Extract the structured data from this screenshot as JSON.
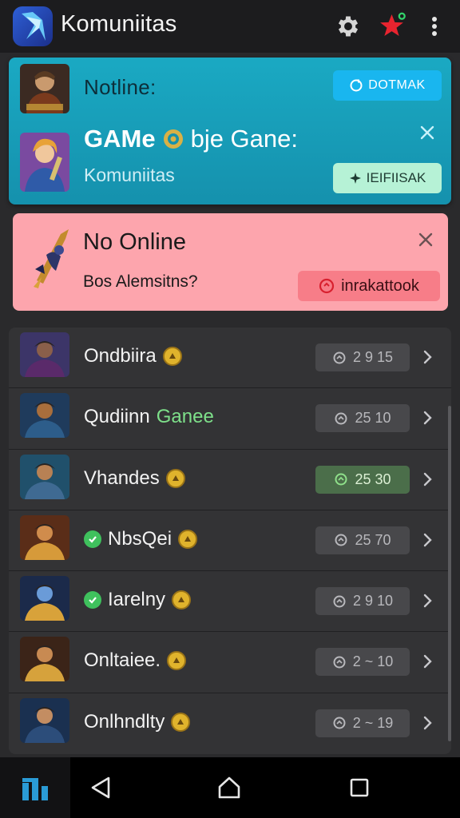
{
  "app": {
    "title": "Komuniitas"
  },
  "colors": {
    "teal_card": "#1aa9c3",
    "pink_card": "#fda5ad",
    "list_bg": "#333335",
    "stat_active": "#4b6e4a"
  },
  "banner_teal": {
    "row1_label": "Notline:",
    "row1_button": "DOTMAK",
    "headline_bold": "GAMe",
    "headline_rest": "bje Gane:",
    "subtitle": "Komuniitas",
    "row2_button": "IEIFIISAK"
  },
  "banner_pink": {
    "title": "No Online",
    "subtitle": "Bos Alemsitns?",
    "button": "inrakattook"
  },
  "games": [
    {
      "name": "Ondbiira",
      "name_extra": "",
      "stat": "2 9 15",
      "lead_badge": false,
      "active": false
    },
    {
      "name": "Qudiinn",
      "name_extra": "Ganee",
      "stat": "25 10",
      "lead_badge": false,
      "active": false
    },
    {
      "name": "Vhandes",
      "name_extra": "",
      "stat": "25 30",
      "lead_badge": false,
      "active": true
    },
    {
      "name": "NbsQei",
      "name_extra": "",
      "stat": "25 70",
      "lead_badge": true,
      "active": false
    },
    {
      "name": "Iarelny",
      "name_extra": "",
      "stat": "2 9 10",
      "lead_badge": true,
      "active": false
    },
    {
      "name": "Onltaiee.",
      "name_extra": "",
      "stat": "2 ~ 10",
      "lead_badge": false,
      "active": false
    },
    {
      "name": "Onlhndlty",
      "name_extra": "",
      "stat": "2 ~ 19",
      "lead_badge": false,
      "active": false
    }
  ],
  "icons": {
    "app_logo": "game-crystal-icon",
    "settings": "gear-icon",
    "favorite": "star-icon",
    "more": "more-vert-icon",
    "close": "close-icon",
    "chevron": "chevron-right-icon"
  }
}
